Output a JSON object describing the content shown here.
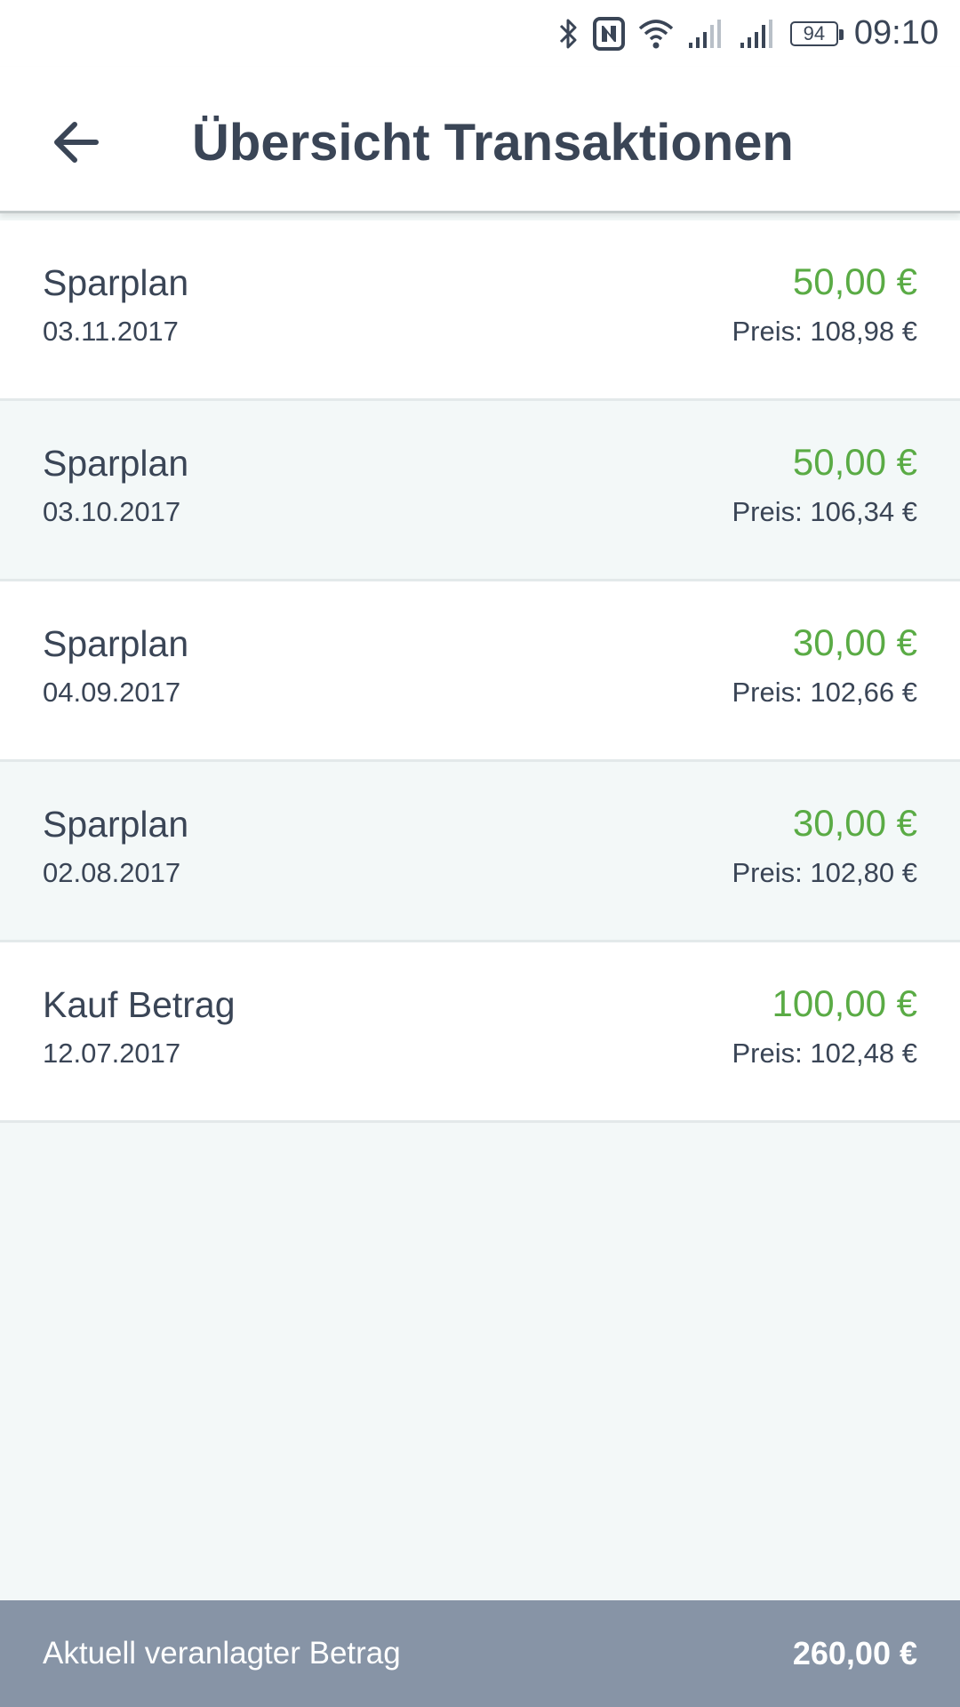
{
  "status_bar": {
    "time": "09:10",
    "battery": "94",
    "icons": [
      "bluetooth-icon",
      "nfc-icon",
      "wifi-icon",
      "signal-icon",
      "signal-icon"
    ]
  },
  "header": {
    "title": "Übersicht Transaktionen",
    "back_icon": "arrow-left-icon"
  },
  "transactions": [
    {
      "name": "Sparplan",
      "date": "03.11.2017",
      "amount": "50,00 €",
      "price": "Preis: 108,98 €"
    },
    {
      "name": "Sparplan",
      "date": "03.10.2017",
      "amount": "50,00 €",
      "price": "Preis: 106,34 €"
    },
    {
      "name": "Sparplan",
      "date": "04.09.2017",
      "amount": "30,00 €",
      "price": "Preis: 102,66 €"
    },
    {
      "name": "Sparplan",
      "date": "02.08.2017",
      "amount": "30,00 €",
      "price": "Preis: 102,80 €"
    },
    {
      "name": "Kauf Betrag",
      "date": "12.07.2017",
      "amount": "100,00 €",
      "price": "Preis: 102,48 €"
    }
  ],
  "footer": {
    "label": "Aktuell veranlagter Betrag",
    "value": "260,00 €"
  },
  "colors": {
    "text": "#3a4556",
    "amount_green": "#5aab45",
    "footer_bg": "#8794a6",
    "alt_row_bg": "#f3f8f8"
  }
}
